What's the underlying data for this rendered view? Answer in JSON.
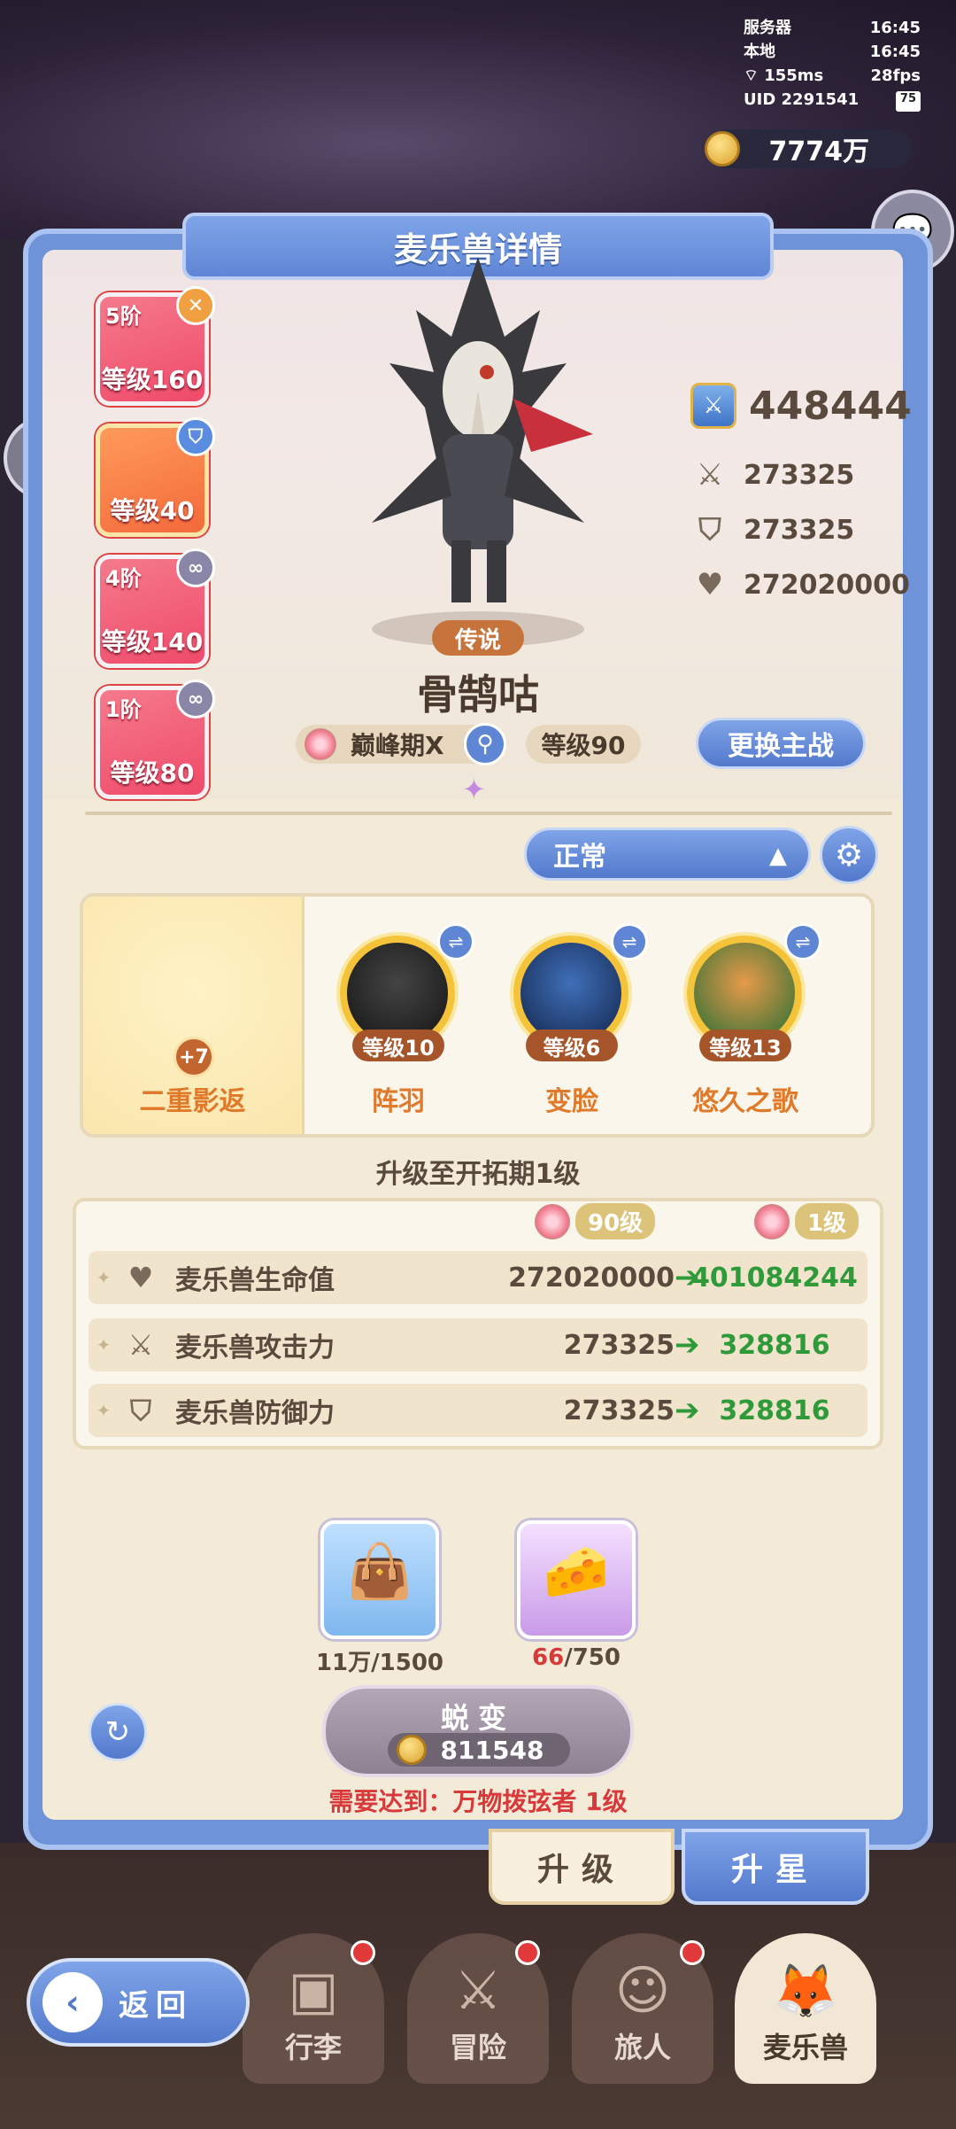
{
  "status": {
    "server_label": "服务器",
    "server_time": "16:45",
    "local_label": "本地",
    "local_time": "16:45",
    "ping": "155ms",
    "fps": "28fps",
    "uid": "UID 2291541",
    "battery": "75"
  },
  "currency": {
    "coins": "7774万"
  },
  "panel": {
    "title": "麦乐兽详情"
  },
  "team": [
    {
      "stage": "5阶",
      "level": "等级160",
      "badge": "x-icon"
    },
    {
      "stage": "",
      "level": "等级40",
      "badge": "shield-icon"
    },
    {
      "stage": "4阶",
      "level": "等级140",
      "badge": "link-icon"
    },
    {
      "stage": "1阶",
      "level": "等级80",
      "badge": "link-icon"
    }
  ],
  "pet": {
    "rarity": "传说",
    "name": "骨鹄咕",
    "stage": "巅峰期X",
    "level": "等级90",
    "change_button": "更换主战"
  },
  "stats": {
    "power": "448444",
    "attack": "273325",
    "defense": "273325",
    "hp": "272020000"
  },
  "mode": {
    "selected": "正常"
  },
  "skills": {
    "main": {
      "name": "二重影返",
      "bonus": "+7"
    },
    "list": [
      {
        "name": "阵羽",
        "level": "等级10"
      },
      {
        "name": "变脸",
        "level": "等级6"
      },
      {
        "name": "悠久之歌",
        "level": "等级13"
      }
    ]
  },
  "upgrade": {
    "hint": "升级至开拓期1级",
    "from_level": "90级",
    "to_level": "1级",
    "rows": [
      {
        "name": "麦乐兽生命值",
        "from": "272020000",
        "to": "401084244",
        "icon": "heart-icon"
      },
      {
        "name": "麦乐兽攻击力",
        "from": "273325",
        "to": "328816",
        "icon": "swords-icon"
      },
      {
        "name": "麦乐兽防御力",
        "from": "273325",
        "to": "328816",
        "icon": "shield-icon"
      }
    ]
  },
  "materials": [
    {
      "name": "food-bag-icon",
      "owned": "11万",
      "required": "/1500"
    },
    {
      "name": "cheese-icon",
      "owned": "66",
      "required": "/750"
    }
  ],
  "evolve": {
    "label": "蜕变",
    "cost": "811548",
    "requirement": "需要达到：万物拨弦者 1级"
  },
  "tabs": {
    "upgrade": "升级",
    "star": "升星"
  },
  "nav": [
    {
      "label": "行李"
    },
    {
      "label": "冒险"
    },
    {
      "label": "旅人"
    },
    {
      "label": "麦乐兽"
    }
  ],
  "back": {
    "label": "返回"
  }
}
